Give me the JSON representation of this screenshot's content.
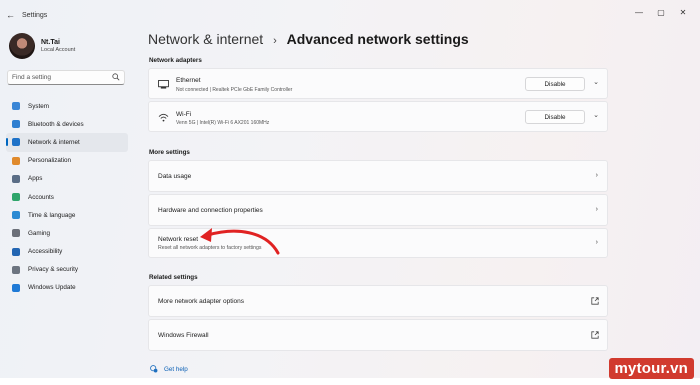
{
  "titlebar": {
    "app_title": "Settings",
    "back_glyph": "←",
    "controls": [
      "—",
      "▢",
      "✕"
    ]
  },
  "profile": {
    "name": "Nt.Tai",
    "account": "Local Account"
  },
  "search": {
    "placeholder": "Find a setting"
  },
  "sidebar": {
    "items": [
      {
        "label": "System",
        "icon": "system-icon",
        "color": "#3a86d6"
      },
      {
        "label": "Bluetooth & devices",
        "icon": "bluetooth-icon",
        "color": "#2f7fd1"
      },
      {
        "label": "Network & internet",
        "icon": "wifi-icon",
        "color": "#1e72c8",
        "active": true
      },
      {
        "label": "Personalization",
        "icon": "brush-icon",
        "color": "#e08a2c"
      },
      {
        "label": "Apps",
        "icon": "apps-icon",
        "color": "#5a6d86"
      },
      {
        "label": "Accounts",
        "icon": "accounts-icon",
        "color": "#2fa56b"
      },
      {
        "label": "Time & language",
        "icon": "globe-clock-icon",
        "color": "#2b8ad3"
      },
      {
        "label": "Gaming",
        "icon": "gaming-icon",
        "color": "#6b6f78"
      },
      {
        "label": "Accessibility",
        "icon": "accessibility-icon",
        "color": "#2366b3"
      },
      {
        "label": "Privacy & security",
        "icon": "shield-icon",
        "color": "#6c7480"
      },
      {
        "label": "Windows Update",
        "icon": "update-icon",
        "color": "#1f7ad6"
      }
    ]
  },
  "breadcrumb": {
    "parent": "Network & internet",
    "separator": "›",
    "current": "Advanced network settings"
  },
  "sections": {
    "adapters": "Network adapters",
    "more": "More settings",
    "related": "Related settings"
  },
  "adapters": [
    {
      "name": "Ethernet",
      "detail": "Not connected | Realtek PCIe GbE Family Controller",
      "button": "Disable",
      "icon": "ethernet-icon"
    },
    {
      "name": "Wi-Fi",
      "detail": "Venn 5G | Intel(R) Wi-Fi 6 AX201 160MHz",
      "button": "Disable",
      "icon": "wifi-signal-icon"
    }
  ],
  "more_settings": [
    {
      "title": "Data usage"
    },
    {
      "title": "Hardware and connection properties"
    },
    {
      "title": "Network reset",
      "subtitle": "Reset all network adapters to factory settings"
    }
  ],
  "related_settings": [
    {
      "title": "More network adapter options"
    },
    {
      "title": "Windows Firewall"
    }
  ],
  "help": {
    "label": "Get help"
  },
  "watermark": "mytour.vn",
  "colors": {
    "accent": "#0067c0",
    "annotation_arrow": "#e02222",
    "watermark_bg": "#d13a2e"
  }
}
